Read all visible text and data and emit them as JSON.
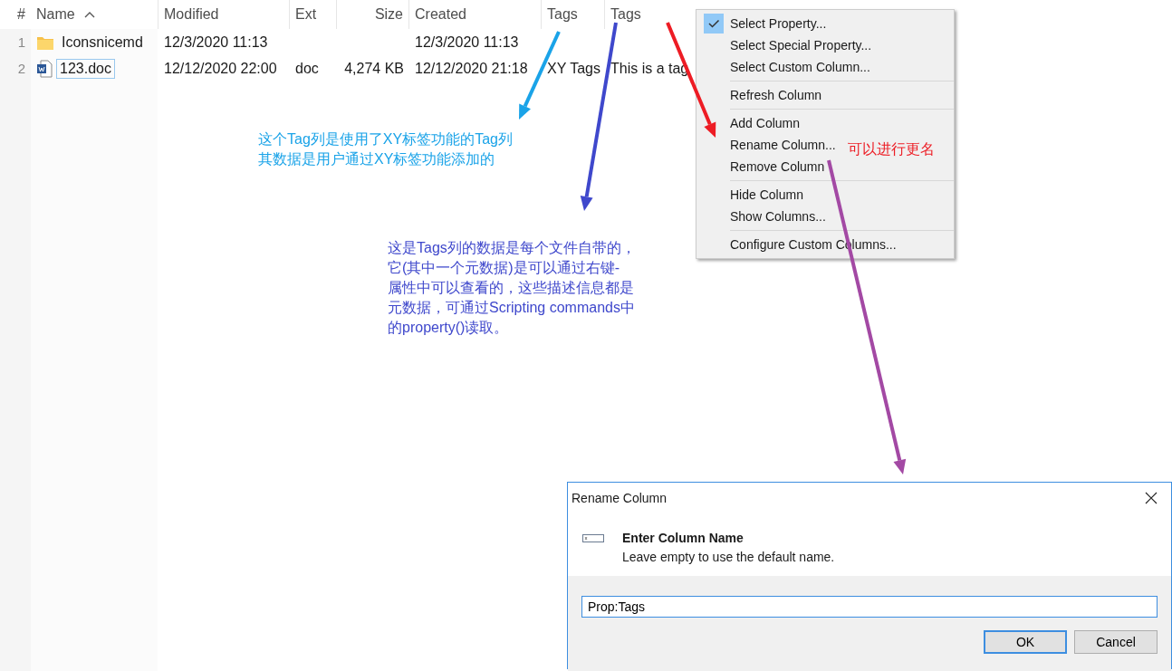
{
  "table": {
    "columns": [
      {
        "label": "#",
        "sorted": false
      },
      {
        "label": "Name",
        "sorted": true
      },
      {
        "label": "Modified",
        "sorted": false
      },
      {
        "label": "Ext",
        "sorted": false
      },
      {
        "label": "Size",
        "sorted": false
      },
      {
        "label": "Created",
        "sorted": false
      },
      {
        "label": "Tags",
        "sorted": false
      },
      {
        "label": "Tags",
        "sorted": false
      }
    ],
    "rows": [
      {
        "index": "1",
        "kind": "folder",
        "name": "Iconsnicemd",
        "focused": false,
        "modified": "12/3/2020 11:13",
        "ext": "",
        "size": "",
        "created": "12/3/2020 11:13",
        "tags": "",
        "tags_2": ""
      },
      {
        "index": "2",
        "kind": "word",
        "name": "123.doc",
        "focused": true,
        "modified": "12/12/2020 22:00",
        "ext": "doc",
        "size": "4,274 KB",
        "created": "12/12/2020 21:18",
        "tags": "XY Tags",
        "tags_2": "This is a tag"
      }
    ]
  },
  "context_menu": {
    "groups": [
      [
        {
          "label": "Select Property...",
          "checked": true
        },
        {
          "label": "Select Special Property...",
          "checked": false
        },
        {
          "label": "Select Custom Column...",
          "checked": false
        }
      ],
      [
        {
          "label": "Refresh Column",
          "checked": false
        }
      ],
      [
        {
          "label": "Add Column",
          "checked": false
        },
        {
          "label": "Rename Column...",
          "checked": false
        },
        {
          "label": "Remove Column",
          "checked": false
        }
      ],
      [
        {
          "label": "Hide Column",
          "checked": false
        },
        {
          "label": "Show Columns...",
          "checked": false
        }
      ],
      [
        {
          "label": "Configure Custom Columns...",
          "checked": false
        }
      ]
    ]
  },
  "annotations": [
    {
      "lines": [
        "这个Tag列是使用了XY标签功能的Tag列",
        "其数据是用户通过XY标签功能添加的"
      ],
      "color": "#1aa3e8"
    },
    {
      "lines": [
        "这是Tags列的数据是每个文件自带的，",
        "它(其中一个元数据)是可以通过右键-",
        "属性中可以查看的，这些描述信息都是",
        "元数据，可通过Scripting commands中",
        "的property()读取。"
      ],
      "color": "#3f48cc"
    },
    {
      "lines": [
        "可以进行更名"
      ],
      "color": "#ed1c24"
    }
  ],
  "arrows": [
    {
      "color": "#1aa3e8"
    },
    {
      "color": "#3f48cc"
    },
    {
      "color": "#ed1c24"
    },
    {
      "color": "#a349a4"
    }
  ],
  "dialog": {
    "title": "Rename Column",
    "heading": "Enter Column Name",
    "description": "Leave empty to use the default name.",
    "value": "Prop:Tags",
    "buttons": [
      {
        "label": "OK",
        "default": true
      },
      {
        "label": "Cancel",
        "default": false
      }
    ]
  }
}
